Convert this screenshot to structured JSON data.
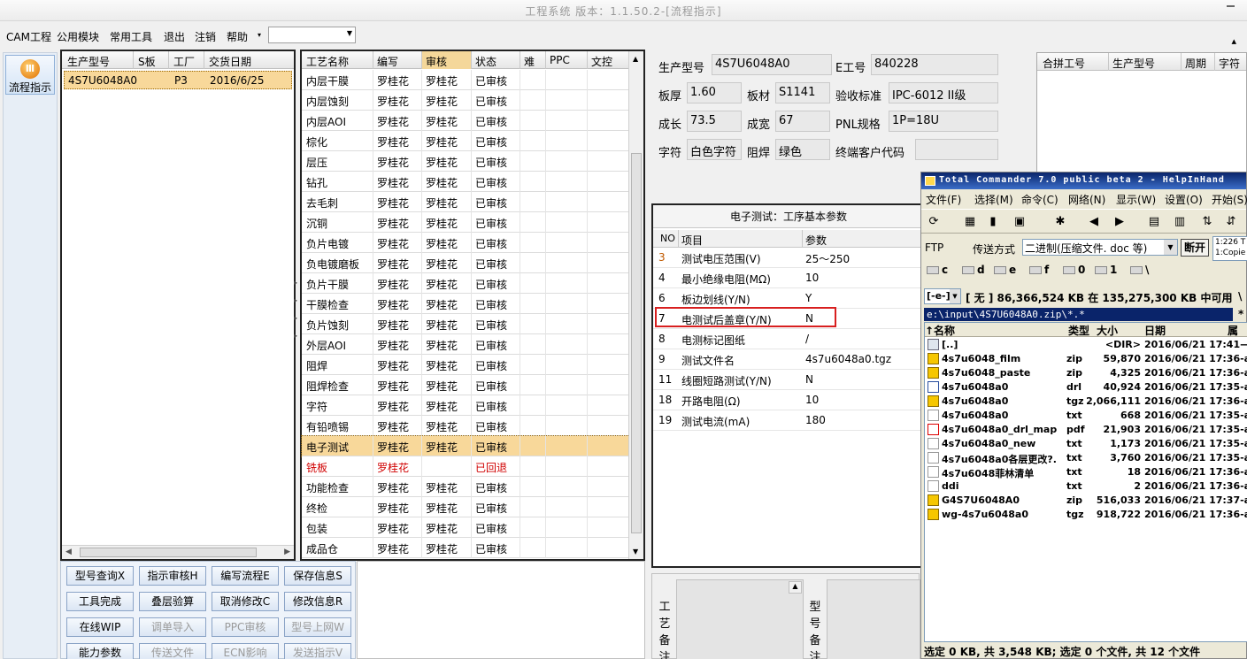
{
  "window": {
    "title": "工程系统 版本：1.1.50.2-[流程指示]"
  },
  "menu": {
    "items": [
      "CAM工程",
      "公用模块",
      "常用工具",
      "退出",
      "注销",
      "帮助"
    ],
    "help_arrow": "▾",
    "combo_value": "",
    "right_icon": "▴"
  },
  "sidebar": {
    "flow_button": "流程指示"
  },
  "products": {
    "headers": [
      "生产型号",
      "S板",
      "工厂",
      "交货日期"
    ],
    "rows": [
      {
        "model": "4S7U6048A0",
        "s": "",
        "factory": "P3",
        "date": "2016/6/25"
      }
    ],
    "scroll_left": "◀",
    "scroll_right": "▶"
  },
  "process": {
    "headers": [
      "工艺名称",
      "编写",
      "审核",
      "状态",
      "难",
      "PPC",
      "文控"
    ],
    "rows": [
      {
        "name": "内层干膜",
        "writer": "罗桂花",
        "reviewer": "罗桂花",
        "status": "已审核"
      },
      {
        "name": "内层蚀刻",
        "writer": "罗桂花",
        "reviewer": "罗桂花",
        "status": "已审核"
      },
      {
        "name": "内层AOI",
        "writer": "罗桂花",
        "reviewer": "罗桂花",
        "status": "已审核"
      },
      {
        "name": "棕化",
        "writer": "罗桂花",
        "reviewer": "罗桂花",
        "status": "已审核"
      },
      {
        "name": "层压",
        "writer": "罗桂花",
        "reviewer": "罗桂花",
        "status": "已审核"
      },
      {
        "name": "钻孔",
        "writer": "罗桂花",
        "reviewer": "罗桂花",
        "status": "已审核"
      },
      {
        "name": "去毛刺",
        "writer": "罗桂花",
        "reviewer": "罗桂花",
        "status": "已审核"
      },
      {
        "name": "沉铜",
        "writer": "罗桂花",
        "reviewer": "罗桂花",
        "status": "已审核"
      },
      {
        "name": "负片电镀",
        "writer": "罗桂花",
        "reviewer": "罗桂花",
        "status": "已审核"
      },
      {
        "name": "负电镀磨板",
        "writer": "罗桂花",
        "reviewer": "罗桂花",
        "status": "已审核"
      },
      {
        "name": "负片干膜",
        "writer": "罗桂花",
        "reviewer": "罗桂花",
        "status": "已审核"
      },
      {
        "name": "干膜检查",
        "writer": "罗桂花",
        "reviewer": "罗桂花",
        "status": "已审核"
      },
      {
        "name": "负片蚀刻",
        "writer": "罗桂花",
        "reviewer": "罗桂花",
        "status": "已审核"
      },
      {
        "name": "外层AOI",
        "writer": "罗桂花",
        "reviewer": "罗桂花",
        "status": "已审核"
      },
      {
        "name": "阻焊",
        "writer": "罗桂花",
        "reviewer": "罗桂花",
        "status": "已审核"
      },
      {
        "name": "阻焊检查",
        "writer": "罗桂花",
        "reviewer": "罗桂花",
        "status": "已审核"
      },
      {
        "name": "字符",
        "writer": "罗桂花",
        "reviewer": "罗桂花",
        "status": "已审核"
      },
      {
        "name": "有铅喷锡",
        "writer": "罗桂花",
        "reviewer": "罗桂花",
        "status": "已审核"
      },
      {
        "name": "电子测试",
        "writer": "罗桂花",
        "reviewer": "罗桂花",
        "status": "已审核"
      },
      {
        "name": "铣板",
        "writer": "罗桂花",
        "reviewer": "",
        "status": "已回退"
      },
      {
        "name": "功能检查",
        "writer": "罗桂花",
        "reviewer": "罗桂花",
        "status": "已审核"
      },
      {
        "name": "终检",
        "writer": "罗桂花",
        "reviewer": "罗桂花",
        "status": "已审核"
      },
      {
        "name": "包装",
        "writer": "罗桂花",
        "reviewer": "罗桂花",
        "status": "已审核"
      },
      {
        "name": "成品仓",
        "writer": "罗桂花",
        "reviewer": "罗桂花",
        "status": "已审核"
      }
    ],
    "selected_index": 18,
    "returned_index": 19,
    "scroll_up": "▲",
    "scroll_down": "▼",
    "splitter_marks": [
      "▸",
      "▸",
      "▸",
      "▸"
    ]
  },
  "buttons": [
    {
      "label": "型号查询X",
      "enabled": true
    },
    {
      "label": "指示审核H",
      "enabled": true
    },
    {
      "label": "编写流程E",
      "enabled": true
    },
    {
      "label": "保存信息S",
      "enabled": true
    },
    {
      "label": "工具完成",
      "enabled": true
    },
    {
      "label": "叠层验算",
      "enabled": true
    },
    {
      "label": "取消修改C",
      "enabled": true
    },
    {
      "label": "修改信息R",
      "enabled": true
    },
    {
      "label": "在线WIP",
      "enabled": true
    },
    {
      "label": "调单导入",
      "enabled": false
    },
    {
      "label": "PPC审核",
      "enabled": false
    },
    {
      "label": "型号上网W",
      "enabled": false
    },
    {
      "label": "能力参数",
      "enabled": true
    },
    {
      "label": "传送文件",
      "enabled": false
    },
    {
      "label": "ECN影响",
      "enabled": false
    },
    {
      "label": "发送指示V",
      "enabled": false
    }
  ],
  "info": {
    "model_label": "生产型号",
    "model_value": "4S7U6048A0",
    "eng_label": "E工号",
    "eng_value": "840228",
    "thickness_label": "板厚",
    "thickness_value": "1.60",
    "material_label": "板材",
    "material_value": "S1141",
    "standard_label": "验收标准",
    "standard_value": "IPC-6012 II级",
    "length_label": "成长",
    "length_value": "73.5",
    "width_label": "成宽",
    "width_value": "67",
    "pnl_label": "PNL规格",
    "pnl_value": "1P=18U",
    "char_label": "字符",
    "char_value": "白色字符",
    "mask_label": "阻焊",
    "mask_value": "绿色",
    "customer_label": "终端客户代码",
    "customer_value": ""
  },
  "merge": {
    "headers": [
      "合拼工号",
      "生产型号",
      "周期",
      "字符"
    ]
  },
  "test": {
    "title": "电子测试：工序基本参数",
    "headers": [
      "NO",
      "项目",
      "参数"
    ],
    "rows": [
      {
        "no": "3",
        "item": "测试电压范围(V)",
        "param": "25～250"
      },
      {
        "no": "4",
        "item": "最小绝缘电阻(MΩ)",
        "param": "10"
      },
      {
        "no": "6",
        "item": "板边划线(Y/N)",
        "param": "Y"
      },
      {
        "no": "7",
        "item": "电测试后盖章(Y/N)",
        "param": "N"
      },
      {
        "no": "8",
        "item": "电测标记图纸",
        "param": "/"
      },
      {
        "no": "9",
        "item": "测试文件名",
        "param": "4s7u6048a0.tgz"
      },
      {
        "no": "11",
        "item": "线圈短路测试(Y/N)",
        "param": "N"
      },
      {
        "no": "18",
        "item": "开路电阻(Ω)",
        "param": "10"
      },
      {
        "no": "19",
        "item": "测试电流(mA)",
        "param": "180"
      }
    ],
    "highlighted_index": 3
  },
  "remarks": {
    "process_label": "工艺备注",
    "model_label": "型号备注"
  },
  "tc": {
    "title": "Total Commander 7.0 public beta 2 - HelpInHand",
    "menu": [
      "文件(F)",
      "选择(M)",
      "命令(C)",
      "网络(N)",
      "显示(W)",
      "设置(O)",
      "开始(S)"
    ],
    "toolbar_icons": [
      "refresh-icon",
      "view-icon",
      "tree-icon",
      "thumbs-icon",
      "star-icon",
      "back-icon",
      "forward-icon",
      "pack-icon",
      "unpack-icon",
      "ftp-icon",
      "url-icon"
    ],
    "toolbar_glyphs": [
      "⟳",
      "▦",
      "▮",
      "▣",
      "✱",
      "◀",
      "▶",
      "▤",
      "▥",
      "⇅",
      "⇵"
    ],
    "ftp_label": "FTP",
    "transfer_label": "传送方式",
    "transfer_value": "二进制(压缩文件. doc 等)",
    "disconnect_label": "断开",
    "ftp_log": [
      "1:226 T",
      "1:Copie"
    ],
    "drives": [
      "c",
      "d",
      "e",
      "f",
      "0",
      "1",
      "\\"
    ],
    "drive_combo": "[-e-]",
    "free_space": "[ 无 ]  86,366,524 KB 在 135,275,300 KB 中可用",
    "path_sep": "\\",
    "star": "*",
    "path": "e:\\input\\4S7U6048A0.zip\\*.*",
    "headers": [
      "↑名称",
      "类型",
      "大小",
      "日期",
      "属"
    ],
    "files": [
      {
        "name": "[..]",
        "type": "",
        "size": "<DIR>",
        "date": "2016/06/21 17:41—"
      },
      {
        "name": "4s7u6048_film",
        "type": "zip",
        "size": "59,870",
        "date": "2016/06/21 17:36-a-"
      },
      {
        "name": "4s7u6048_paste",
        "type": "zip",
        "size": "4,325",
        "date": "2016/06/21 17:36-a-"
      },
      {
        "name": "4s7u6048a0",
        "type": "drl",
        "size": "40,924",
        "date": "2016/06/21 17:35-a-"
      },
      {
        "name": "4s7u6048a0",
        "type": "tgz",
        "size": "2,066,111",
        "date": "2016/06/21 17:36-a-"
      },
      {
        "name": "4s7u6048a0",
        "type": "txt",
        "size": "668",
        "date": "2016/06/21 17:35-a-"
      },
      {
        "name": "4s7u6048a0_drl_map",
        "type": "pdf",
        "size": "21,903",
        "date": "2016/06/21 17:35-a-"
      },
      {
        "name": "4s7u6048a0_new",
        "type": "txt",
        "size": "1,173",
        "date": "2016/06/21 17:35-a-"
      },
      {
        "name": "4s7u6048a0各层更改?.",
        "type": "txt",
        "size": "3,760",
        "date": "2016/06/21 17:35-a-"
      },
      {
        "name": "4s7u6048菲林清单",
        "type": "txt",
        "size": "18",
        "date": "2016/06/21 17:36-a-"
      },
      {
        "name": "ddi",
        "type": "txt",
        "size": "2",
        "date": "2016/06/21 17:36-a-"
      },
      {
        "name": "G4S7U6048A0",
        "type": "zip",
        "size": "516,033",
        "date": "2016/06/21 17:37-a-"
      },
      {
        "name": "wg-4s7u6048a0",
        "type": "tgz",
        "size": "918,722",
        "date": "2016/06/21 17:36-a-"
      }
    ],
    "status": "选定 0 KB, 共 3,548 KB; 选定 0 个文件, 共 12 个文件"
  }
}
